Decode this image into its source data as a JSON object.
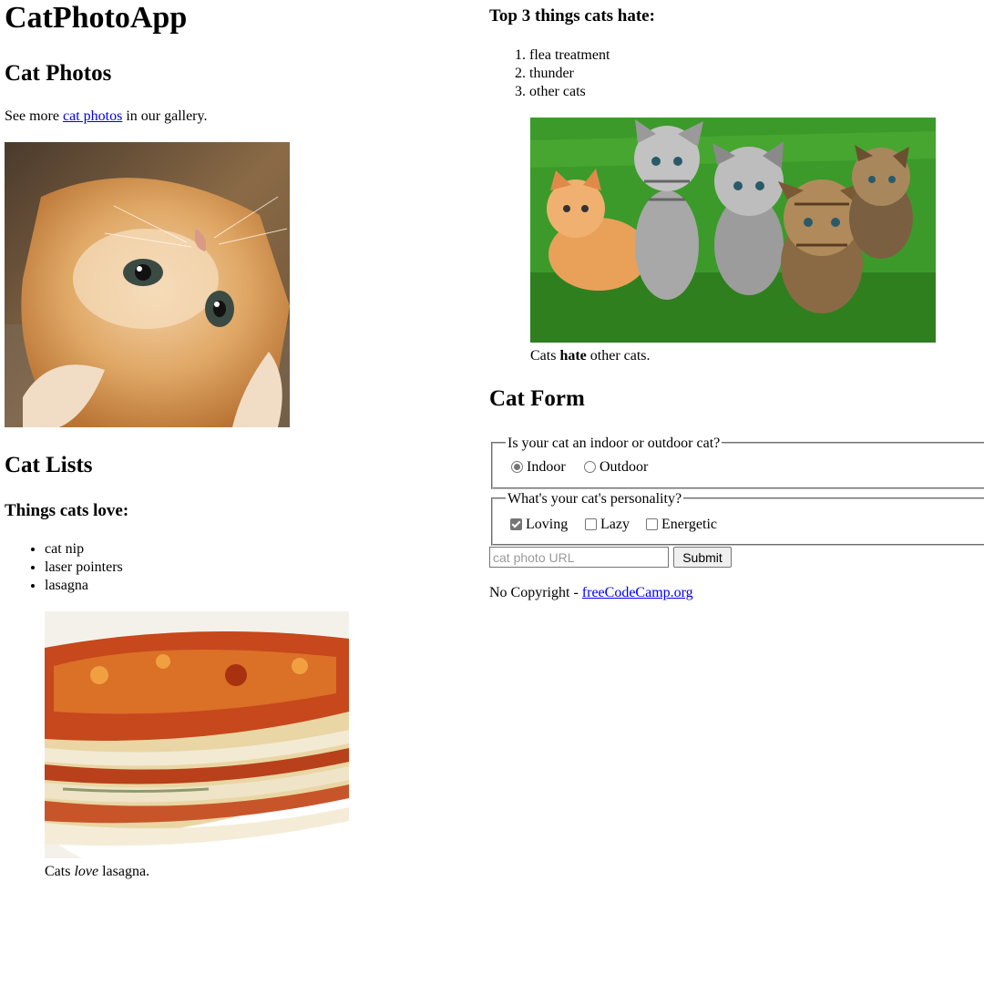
{
  "app_title": "CatPhotoApp",
  "photos_section": {
    "heading": "Cat Photos",
    "text_before": "See more ",
    "link_text": "cat photos",
    "text_after": " in our gallery."
  },
  "lists_section": {
    "heading": "Cat Lists",
    "love_heading": "Things cats love:",
    "love_items": [
      "cat nip",
      "laser pointers",
      "lasagna"
    ],
    "love_caption_before": "Cats ",
    "love_caption_em": "love",
    "love_caption_after": " lasagna.",
    "hate_heading": "Top 3 things cats hate:",
    "hate_items": [
      "flea treatment",
      "thunder",
      "other cats"
    ],
    "hate_caption_before": "Cats ",
    "hate_caption_strong": "hate",
    "hate_caption_after": " other cats."
  },
  "form_section": {
    "heading": "Cat Form",
    "location_legend": "Is your cat an indoor or outdoor cat?",
    "location_options": [
      {
        "label": "Indoor",
        "checked": true
      },
      {
        "label": "Outdoor",
        "checked": false
      }
    ],
    "personality_legend": "What's your cat's personality?",
    "personality_options": [
      {
        "label": "Loving",
        "checked": true
      },
      {
        "label": "Lazy",
        "checked": false
      },
      {
        "label": "Energetic",
        "checked": false
      }
    ],
    "url_placeholder": "cat photo URL",
    "submit_label": "Submit"
  },
  "footer": {
    "text": "No Copyright - ",
    "link_text": "freeCodeCamp.org"
  },
  "colors": {
    "link": "#0000ee",
    "grass": "#3c9a2a",
    "kitten_orange": "#d98a3a",
    "lasagna_red": "#c6481c"
  },
  "images": [
    "relaxing-cat-icon",
    "lasagna-icon",
    "kittens-icon"
  ]
}
